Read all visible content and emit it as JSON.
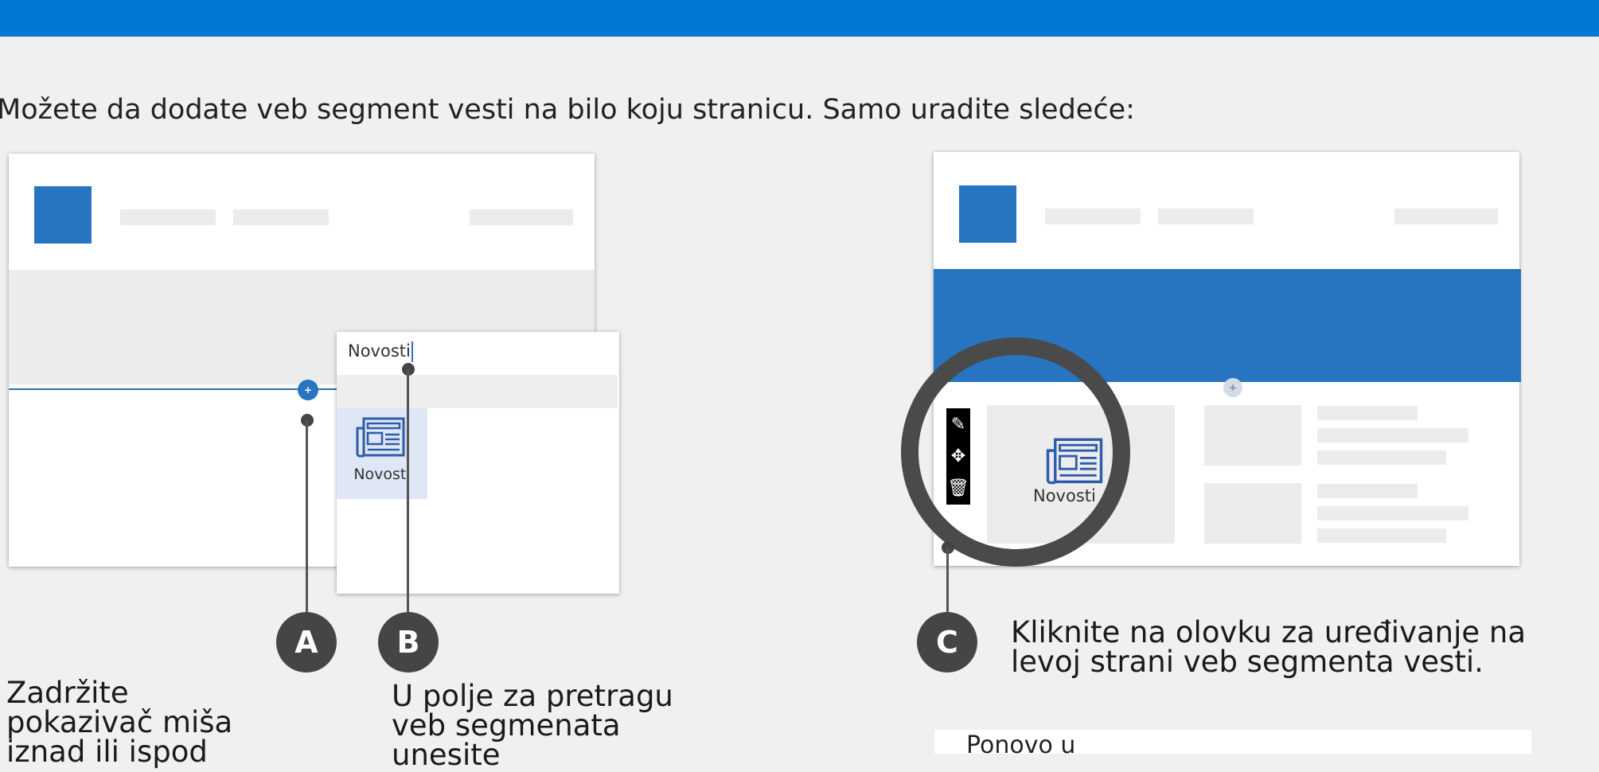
{
  "intro": "Možete da dodate veb segment vesti na bilo koju stranicu. Samo uradite sledeće:",
  "search": {
    "query": "Novosti"
  },
  "news_tile_label": "Novosti",
  "news_label_c": "Novosti",
  "steps": [
    {
      "badge": "A",
      "text": "Zadržite pokazivač miša iznad ili ispod"
    },
    {
      "badge": "B",
      "text": "U polje za pretragu veb segmenata unesite"
    },
    {
      "badge": "C",
      "text": "Kliknite na olovku za uređivanje na levoj strani veb segmenta vesti."
    }
  ],
  "bottom_text": "Ponovo u",
  "icons": {
    "plus": "plus-icon",
    "pencil": "pencil-icon",
    "move": "move-icon",
    "trash": "trash-icon",
    "newspaper": "newspaper-icon"
  },
  "colors": {
    "header": "#0078d4",
    "accent": "#2775c0",
    "badge": "#454545"
  }
}
